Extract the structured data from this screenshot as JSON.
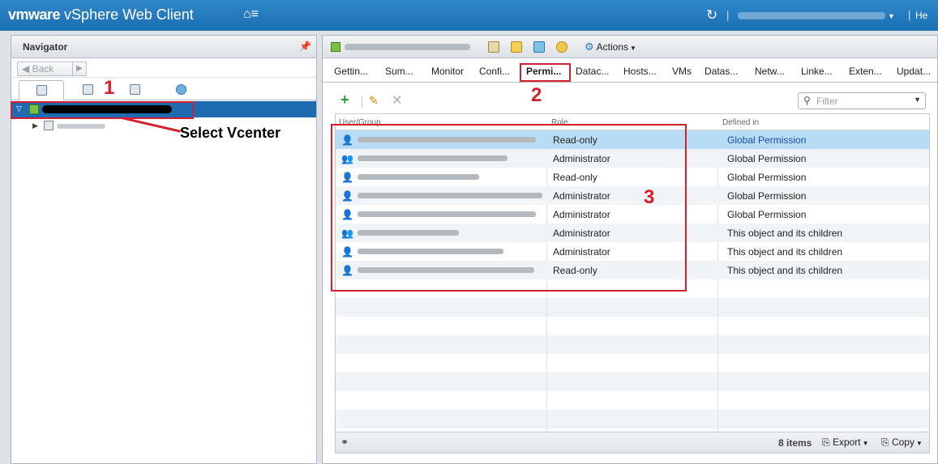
{
  "header": {
    "brand_bold": "vmware",
    "brand_rest": " vSphere Web Client",
    "help_label": "He"
  },
  "navigator": {
    "title": "Navigator",
    "back_label": "Back"
  },
  "toolbar": {
    "actions_label": "Actions",
    "filter_placeholder": "Filter"
  },
  "tabs": [
    {
      "label": "Gettin..."
    },
    {
      "label": "Sum..."
    },
    {
      "label": "Monitor"
    },
    {
      "label": "Confi..."
    },
    {
      "label": "Permi...",
      "active": true
    },
    {
      "label": "Datac..."
    },
    {
      "label": "Hosts..."
    },
    {
      "label": "VMs"
    },
    {
      "label": "Datas..."
    },
    {
      "label": "Netw..."
    },
    {
      "label": "Linke..."
    },
    {
      "label": "Exten..."
    },
    {
      "label": "Updat..."
    }
  ],
  "table": {
    "headers": [
      "User/Group",
      "Role",
      "Defined in"
    ],
    "rows": [
      {
        "role": "Read-only",
        "defined_in": "Global Permission",
        "group": false
      },
      {
        "role": "Administrator",
        "defined_in": "Global Permission",
        "group": true
      },
      {
        "role": "Read-only",
        "defined_in": "Global Permission",
        "group": false
      },
      {
        "role": "Administrator",
        "defined_in": "Global Permission",
        "group": false
      },
      {
        "role": "Administrator",
        "defined_in": "Global Permission",
        "group": false
      },
      {
        "role": "Administrator",
        "defined_in": "This object and its children",
        "group": true
      },
      {
        "role": "Administrator",
        "defined_in": "This object and its children",
        "group": false
      },
      {
        "role": "Read-only",
        "defined_in": "This object and its children",
        "group": false
      }
    ]
  },
  "status": {
    "count": "8 items",
    "export_label": "Export",
    "copy_label": "Copy"
  },
  "annotations": {
    "step1": "1",
    "step2": "2",
    "step3": "3",
    "select_text": "Select Vcenter"
  },
  "colors": {
    "header_blue": "#1b6fb3",
    "selection_blue": "#1f6bb2",
    "row_selected": "#b9dcf5",
    "annotation_red": "#d3202e"
  }
}
